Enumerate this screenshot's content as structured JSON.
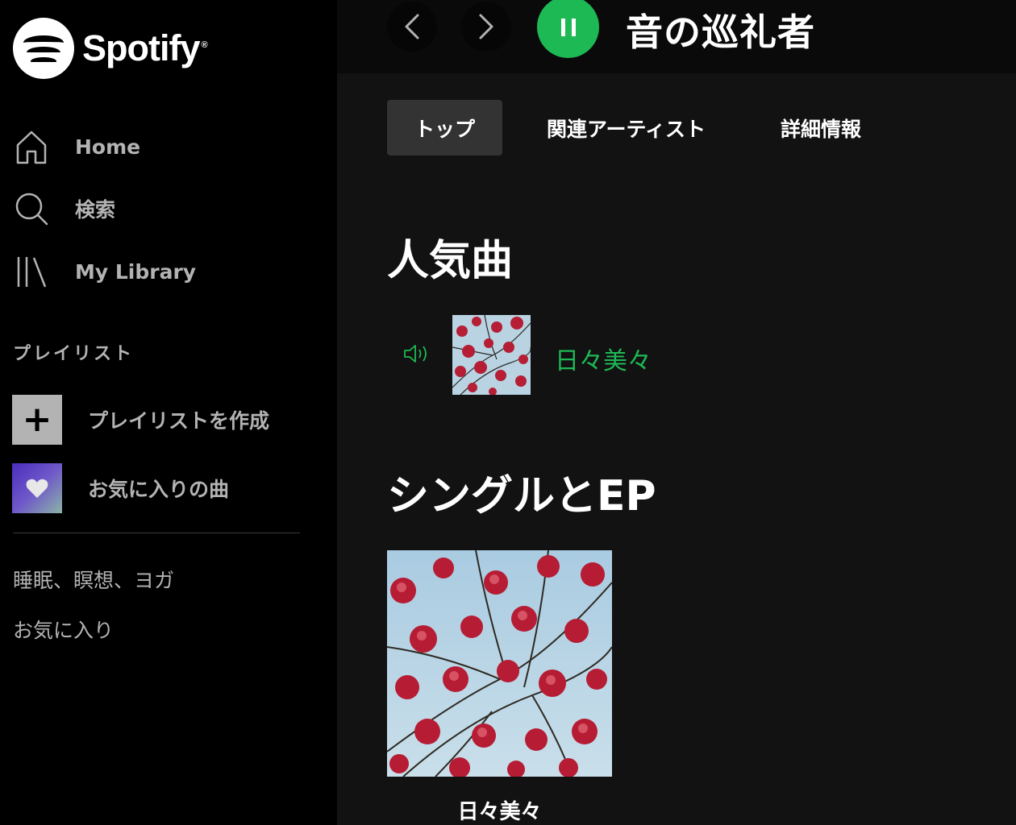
{
  "brand": {
    "name": "Spotify",
    "reg_mark": "®",
    "logo_icon": "spotify-logo-icon"
  },
  "nav": [
    {
      "label": "Home",
      "icon": "home-icon"
    },
    {
      "label": "検索",
      "icon": "search-icon"
    },
    {
      "label": "My Library",
      "icon": "library-icon"
    }
  ],
  "sidebar": {
    "section_title": "プレイリスト",
    "create_playlist_label": "プレイリストを作成",
    "create_playlist_icon": "plus-icon",
    "liked_songs_label": "お気に入りの曲",
    "liked_songs_icon": "heart-icon",
    "playlists": [
      "睡眠、瞑想、ヨガ",
      "お気に入り"
    ]
  },
  "topbar": {
    "back_icon": "chevron-left-icon",
    "forward_icon": "chevron-right-icon",
    "play_icon": "pause-icon",
    "artist_name": "音の巡礼者"
  },
  "tabs": [
    {
      "label": "トップ",
      "active": true
    },
    {
      "label": "関連アーティスト",
      "active": false
    },
    {
      "label": "詳細情報",
      "active": false
    }
  ],
  "popular": {
    "heading": "人気曲",
    "tracks": [
      {
        "title": "日々美々",
        "now_playing": true,
        "status_icon": "speaker-icon"
      }
    ]
  },
  "singles": {
    "heading": "シングルとEP",
    "albums": [
      {
        "title": "日々美々"
      }
    ]
  },
  "colors": {
    "accent": "#1db954",
    "sidebar_bg": "#000000",
    "main_bg": "#121212",
    "tab_active_bg": "#333333",
    "muted_text": "#b3b3b3"
  }
}
